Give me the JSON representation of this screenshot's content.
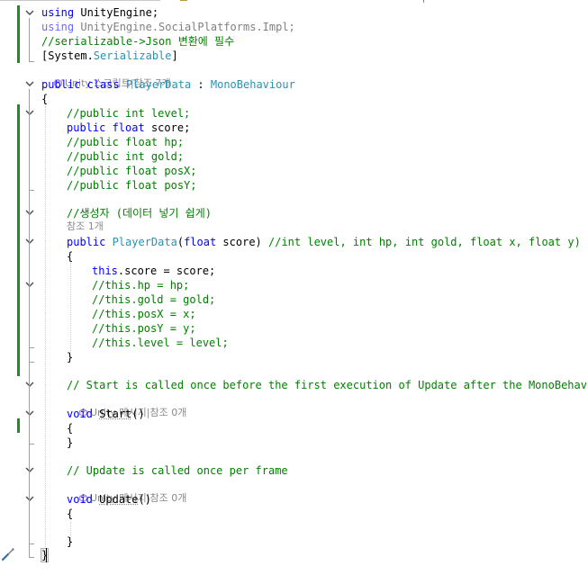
{
  "editor": {
    "lines": {
      "l1_using": "using",
      "l1_ns": " UnityEngine;",
      "l2_using": "using",
      "l2_ns": " UnityEngine.SocialPlatforms.Impl;",
      "l3_comment": "//serializable->Json 변환에 필수",
      "l4_open": "[System.",
      "l4_attr": "Serializable",
      "l4_close": "]",
      "lens_class": "Unity 스크립트|참조 7개",
      "l5_public": "public",
      "l5_class": " class ",
      "l5_name": "PlayerData",
      "l5_colon": " : ",
      "l5_base": "MonoBehaviour",
      "l6_brace": "{",
      "l8_comment": "//public int level;",
      "l9_public": "public",
      "l9_float": " float",
      "l9_rest": " score;",
      "l10_comment": "//public float hp;",
      "l11_comment": "//public int gold;",
      "l12_comment": "//public float posX;",
      "l13_comment": "//public float posY;",
      "l15_comment": "//생성자 (데이터 넣기 쉽게)",
      "lens_ctor": "참조 1개",
      "l16_public": "public",
      "l16_name": " PlayerData",
      "l16_paren": "(",
      "l16_float": "float",
      "l16_param": " score)",
      "l16_comment": " //int level, int hp, int gold, float x, float y)",
      "l17_brace": "{",
      "l18_this": "this",
      "l18_rest": ".score = score;",
      "l19_comment": "//this.hp = hp;",
      "l20_comment": "//this.gold = gold;",
      "l21_comment": "//this.posX = x;",
      "l22_comment": "//this.posY = y;",
      "l23_comment": "//this.level = level;",
      "l24_brace": "}",
      "l26_comment": "// Start is called once before the first execution of Update after the MonoBehaviour is created",
      "lens_start": "Unity 메시지|참조 0개",
      "l27_void": "void",
      "l27_name": "Start",
      "l27_parens": "()",
      "l28_brace": "{",
      "l29_brace": "}",
      "l31_comment": "// Update is called once per frame",
      "lens_update": "Unity 메시지|참조 0개",
      "l32_void": "void",
      "l32_name": "Update",
      "l32_parens": "()",
      "l33_brace": "{",
      "l35_brace": "}",
      "l36_brace": "}"
    },
    "colors": {
      "keyword": "#0000ff",
      "type": "#2b91af",
      "comment": "#008000",
      "changed_margin": "#1f8e1f"
    },
    "icons": [
      "chevron-down-icon",
      "unity-icon",
      "quick-actions-screwdriver-icon"
    ]
  }
}
